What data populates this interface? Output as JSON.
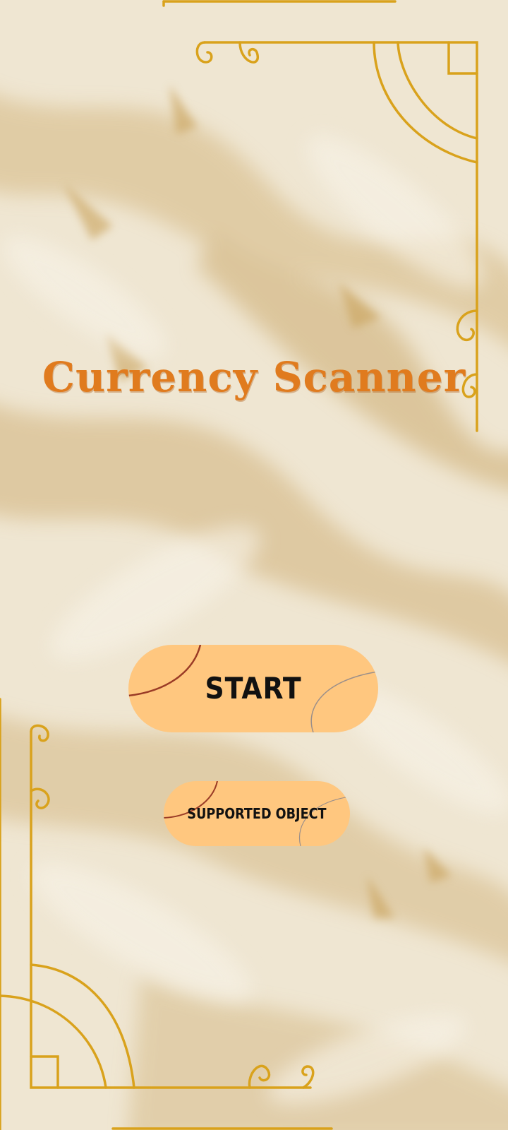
{
  "app": {
    "title": "Currency Scanner"
  },
  "buttons": {
    "start_label": "START",
    "supported_label": "SUPPORTED OBJECT"
  },
  "colors": {
    "background": "#efe6d2",
    "marble_vein": "#d8c08f",
    "gold_frame": "#d9a21c",
    "title": "#e07b1e",
    "button_fill": "#ffc77f",
    "button_text": "#111111"
  }
}
